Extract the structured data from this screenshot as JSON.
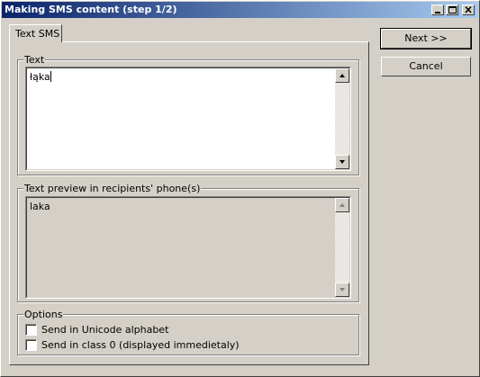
{
  "window": {
    "title": "Making SMS content (step 1/2)",
    "controls": {
      "minimize": "minimize-icon",
      "maximize": "maximize-icon",
      "close": "close-icon"
    }
  },
  "tabs": [
    {
      "label": "Text SMS",
      "active": true
    }
  ],
  "text_group": {
    "label": "Text",
    "value": "łąka"
  },
  "preview_group": {
    "label": "Text preview in recipients' phone(s)",
    "value": "laka"
  },
  "options_group": {
    "label": "Options",
    "checkboxes": [
      {
        "label": "Send in Unicode alphabet",
        "checked": false
      },
      {
        "label": "Send in class 0 (displayed immedietaly)",
        "checked": false
      }
    ]
  },
  "buttons": {
    "next": "Next >>",
    "cancel": "Cancel"
  },
  "colors": {
    "title_start": "#0a246a",
    "title_end": "#a6caf0",
    "face": "#d4d0c8"
  }
}
